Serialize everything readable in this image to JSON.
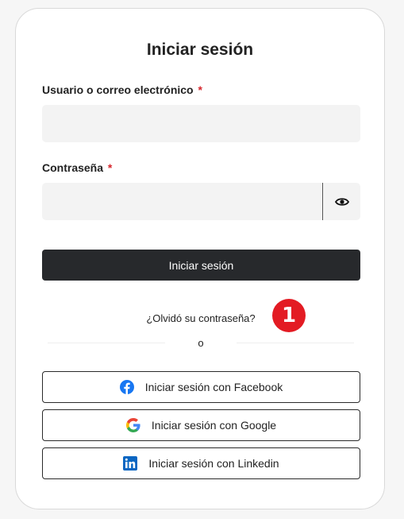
{
  "title": "Iniciar sesión",
  "username": {
    "label": "Usuario o correo electrónico",
    "required_mark": "*",
    "value": ""
  },
  "password": {
    "label": "Contraseña",
    "required_mark": "*",
    "value": "",
    "toggle_icon": "eye-icon"
  },
  "submit_label": "Iniciar sesión",
  "forgot_label": "¿Olvidó su contraseña?",
  "annotation_badge": "1",
  "separator": "o",
  "social": {
    "facebook": {
      "label": "Iniciar sesión con Facebook",
      "icon": "facebook-icon"
    },
    "google": {
      "label": "Iniciar sesión con Google",
      "icon": "google-icon"
    },
    "linkedin": {
      "label": "Iniciar sesión con Linkedin",
      "icon": "linkedin-icon"
    }
  },
  "colors": {
    "primary_button": "#27292c",
    "required": "#d6262c",
    "badge": "#e31b23",
    "facebook": "#1877f2",
    "linkedin": "#0a66c2"
  }
}
